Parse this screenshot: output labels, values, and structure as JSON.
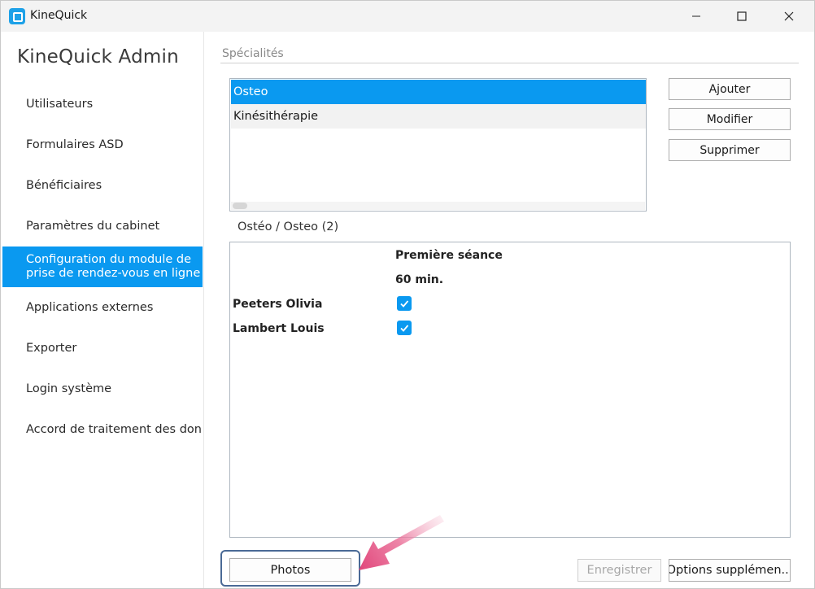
{
  "window": {
    "title": "KineQuick",
    "controls": [
      "minimize-icon",
      "maximize-icon",
      "close-icon"
    ]
  },
  "sidebar": {
    "title": "KineQuick Admin",
    "items": [
      {
        "label": "Utilisateurs"
      },
      {
        "label": "Formulaires ASD"
      },
      {
        "label": "Bénéficiaires"
      },
      {
        "label": "Paramètres du cabinet"
      },
      {
        "label": "Configuration du module de prise de rendez-vous en ligne",
        "active": true
      },
      {
        "label": "Applications externes"
      },
      {
        "label": "Exporter"
      },
      {
        "label": "Login système"
      },
      {
        "label": "Accord de traitement des données"
      }
    ]
  },
  "specialites": {
    "section_label": "Spécialités",
    "items": [
      {
        "label": "Osteo",
        "selected": true
      },
      {
        "label": "Kinésithérapie",
        "selected": false
      }
    ],
    "buttons": {
      "add": "Ajouter",
      "edit": "Modifier",
      "delete": "Supprimer"
    }
  },
  "group": {
    "label": "Ostéo / Osteo (2)",
    "column_header": "Première séance",
    "column_subheader": "60 min.",
    "rows": [
      {
        "name": "Peeters Olivia",
        "checked": true
      },
      {
        "name": "Lambert Louis",
        "checked": true
      }
    ]
  },
  "footer": {
    "photos": "Photos",
    "save": "Enregistrer",
    "options": "Options supplémen..."
  },
  "colors": {
    "accent": "#0a99f0",
    "annotation_arrow": "#e0457a",
    "highlight_border": "#4a6a96"
  }
}
